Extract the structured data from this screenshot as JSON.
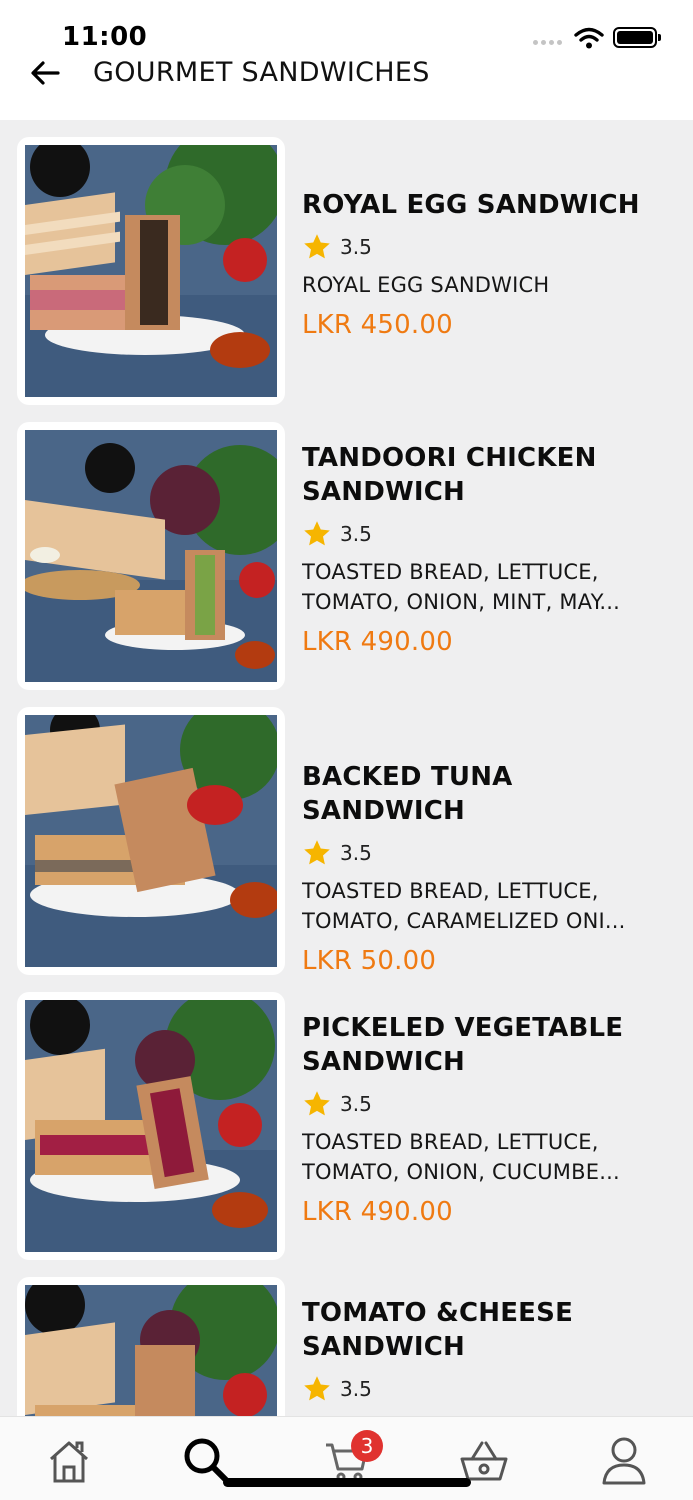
{
  "status_bar": {
    "time": "11:00"
  },
  "header": {
    "title": "GOURMET SANDWICHES"
  },
  "items": [
    {
      "name": "ROYAL EGG SANDWICH",
      "rating": "3.5",
      "description": "ROYAL EGG SANDWICH",
      "price": "LKR 450.00"
    },
    {
      "name": "TANDOORI CHICKEN SANDWICH",
      "rating": "3.5",
      "description": "TOASTED BREAD, LETTUCE, TOMATO, ONION, MINT, MAY...",
      "price": "LKR 490.00"
    },
    {
      "name": "BACKED TUNA SANDWICH",
      "rating": "3.5",
      "description": "TOASTED BREAD, LETTUCE, TOMATO, CARAMELIZED ONI...",
      "price": "LKR 50.00"
    },
    {
      "name": "PICKELED VEGETABLE SANDWICH",
      "rating": "3.5",
      "description": "TOASTED BREAD, LETTUCE, TOMATO, ONION, CUCUMBE...",
      "price": "LKR 490.00"
    },
    {
      "name": "TOMATO &CHEESE SANDWICH",
      "rating": "3.5",
      "description": "",
      "price": ""
    }
  ],
  "bottom_nav": {
    "items": [
      "home-icon",
      "search-icon",
      "cart-icon",
      "basket-icon",
      "profile-icon"
    ],
    "cart_badge": "3"
  },
  "colors": {
    "price": "#ef7a12",
    "star": "#f6b500",
    "badge": "#e0322f"
  }
}
